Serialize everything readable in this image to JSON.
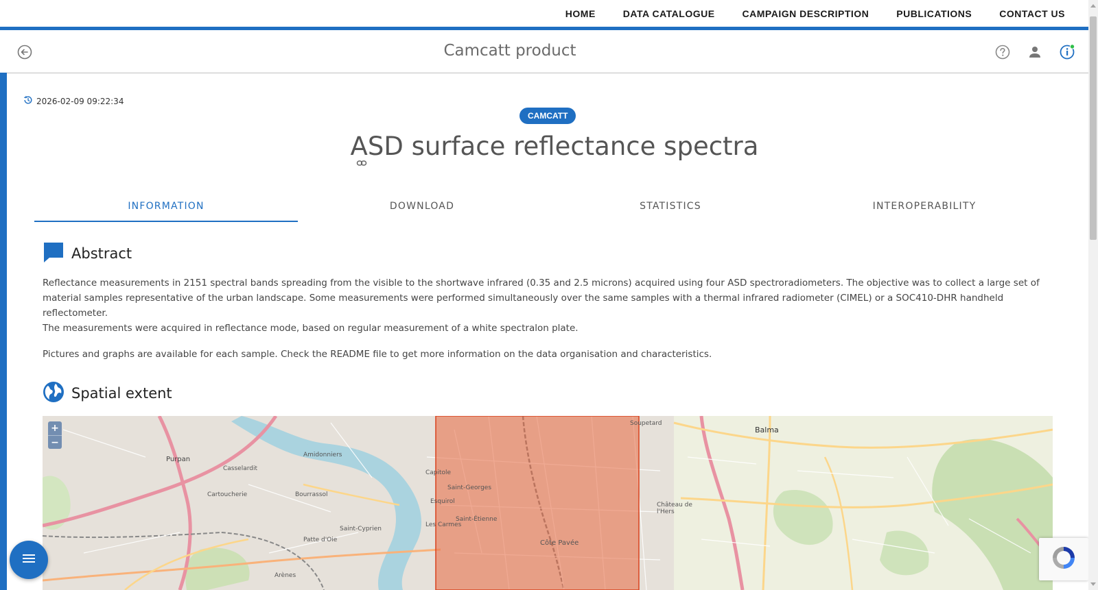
{
  "nav": {
    "links": [
      "HOME",
      "DATA CATALOGUE",
      "CAMPAIGN DESCRIPTION",
      "PUBLICATIONS",
      "CONTACT US"
    ]
  },
  "header": {
    "title": "Camcatt product",
    "icons": [
      "back-arrow-icon",
      "help-icon",
      "user-icon",
      "info-icon"
    ]
  },
  "product": {
    "timestamp": "2026-02-09 09:22:34",
    "badge": "CAMCATT",
    "title": "ASD surface reflectance spectra"
  },
  "tabs": [
    "INFORMATION",
    "DOWNLOAD",
    "STATISTICS",
    "INTEROPERABILITY"
  ],
  "active_tab": "INFORMATION",
  "abstract": {
    "heading": "Abstract",
    "para1": "Reflectance measurements in 2151 spectral bands spreading from the visible to the shortwave infrared (0.35 and 2.5 microns) acquired using four ASD spectroradiometers. The objective was to collect a large set of material samples representative of the urban landscape. Some measurements were performed simultaneously over the same samples with a thermal infrared radiometer (CIMEL) or a SOC410-DHR handheld reflectometer.",
    "para2": "The measurements were acquired in reflectance mode, based on regular measurement of a white spectralon plate.",
    "para3": "Pictures and graphs are available for each sample. Check the README file to get more information on the data organisation and characteristics."
  },
  "spatial": {
    "heading": "Spatial extent",
    "zoom_in": "+",
    "zoom_out": "−",
    "map_labels": [
      "Purpan",
      "Casselardit",
      "Amidonniers",
      "Capitole",
      "Saint-Georges",
      "Saint-Étienne",
      "Côte Pavée",
      "Balma",
      "Soupetard",
      "Bourrassol",
      "Cartoucherie",
      "Saint-Cyprien",
      "Patte d'Oie",
      "Esquirol",
      "Les Carmes",
      "Château de l'Hers",
      "Arènes"
    ],
    "colors": {
      "extent_fill": "#e8734f",
      "extent_stroke": "#d9401c"
    }
  },
  "colors": {
    "primary": "#1f6fc2",
    "nav_text": "#1a1a1a"
  }
}
